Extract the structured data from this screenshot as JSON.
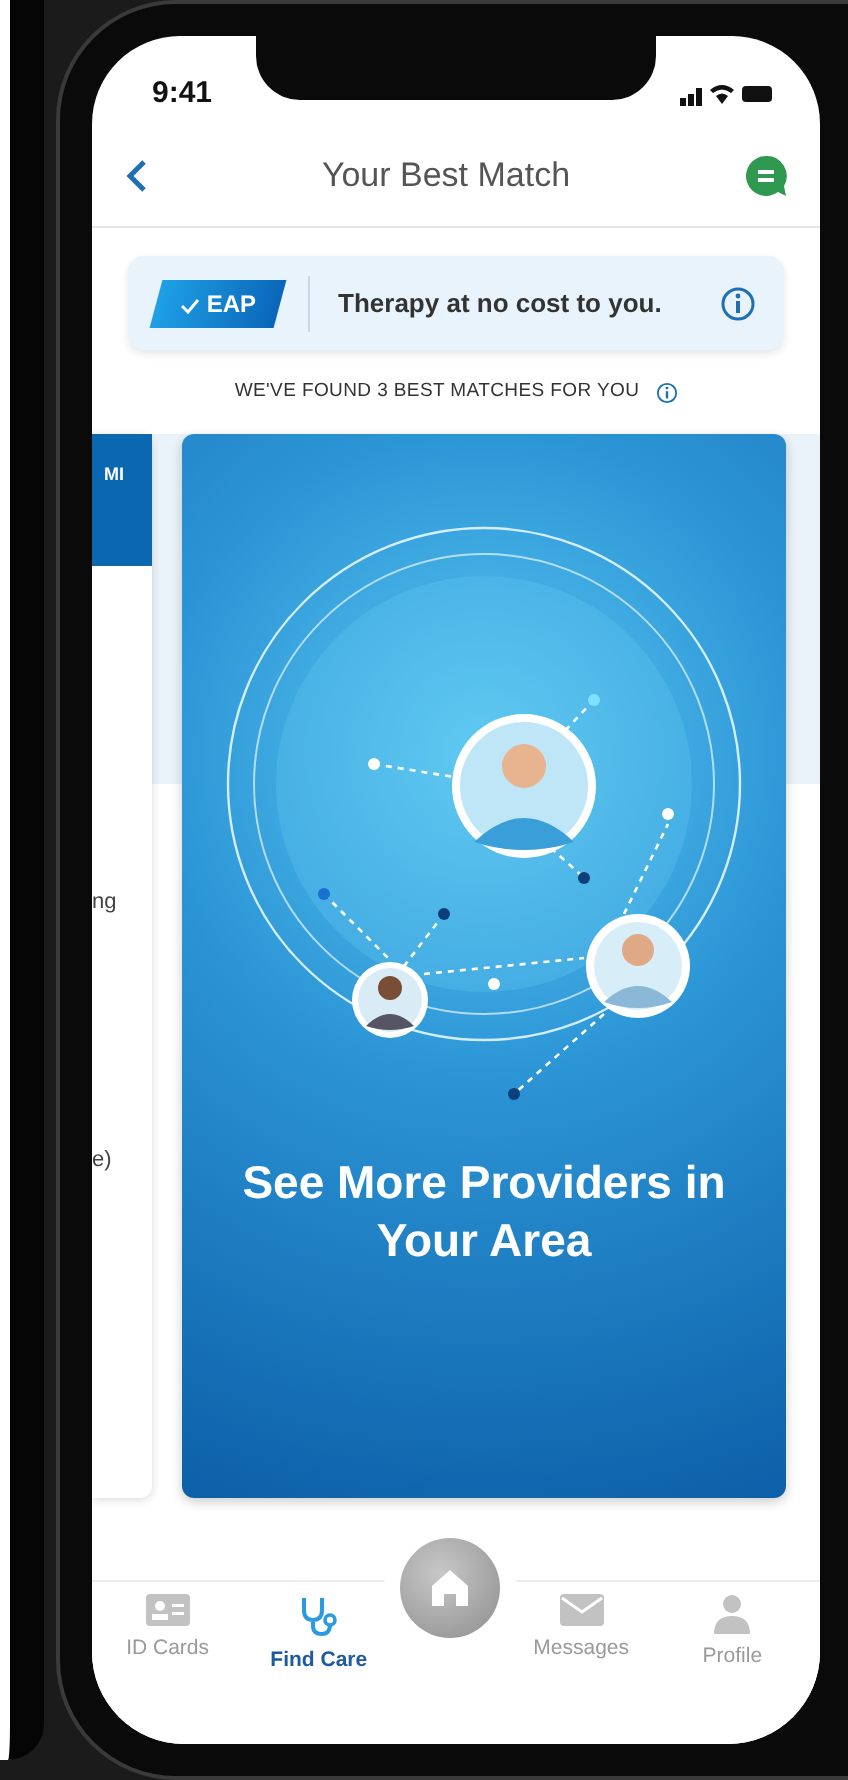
{
  "status_bar": {
    "time": "9:41"
  },
  "header": {
    "title": "Your Best Match"
  },
  "eap_banner": {
    "badge": "EAP",
    "text": "Therapy at no cost to you."
  },
  "matches_caption": "WE'VE FOUND 3 BEST MATCHES FOR YOU",
  "side_card": {
    "header": "MI",
    "lines": [
      "ng",
      "e)"
    ]
  },
  "promo_card": {
    "title": "See More Providers in Your Area"
  },
  "tab_bar": [
    {
      "label": "ID Cards",
      "kind": "idcard",
      "selected": false
    },
    {
      "label": "Find Care",
      "kind": "stethoscope",
      "selected": true
    },
    {
      "kind": "home",
      "selected": false
    },
    {
      "label": "Messages",
      "kind": "envelope",
      "selected": false
    },
    {
      "label": "Profile",
      "kind": "person",
      "selected": false
    }
  ]
}
